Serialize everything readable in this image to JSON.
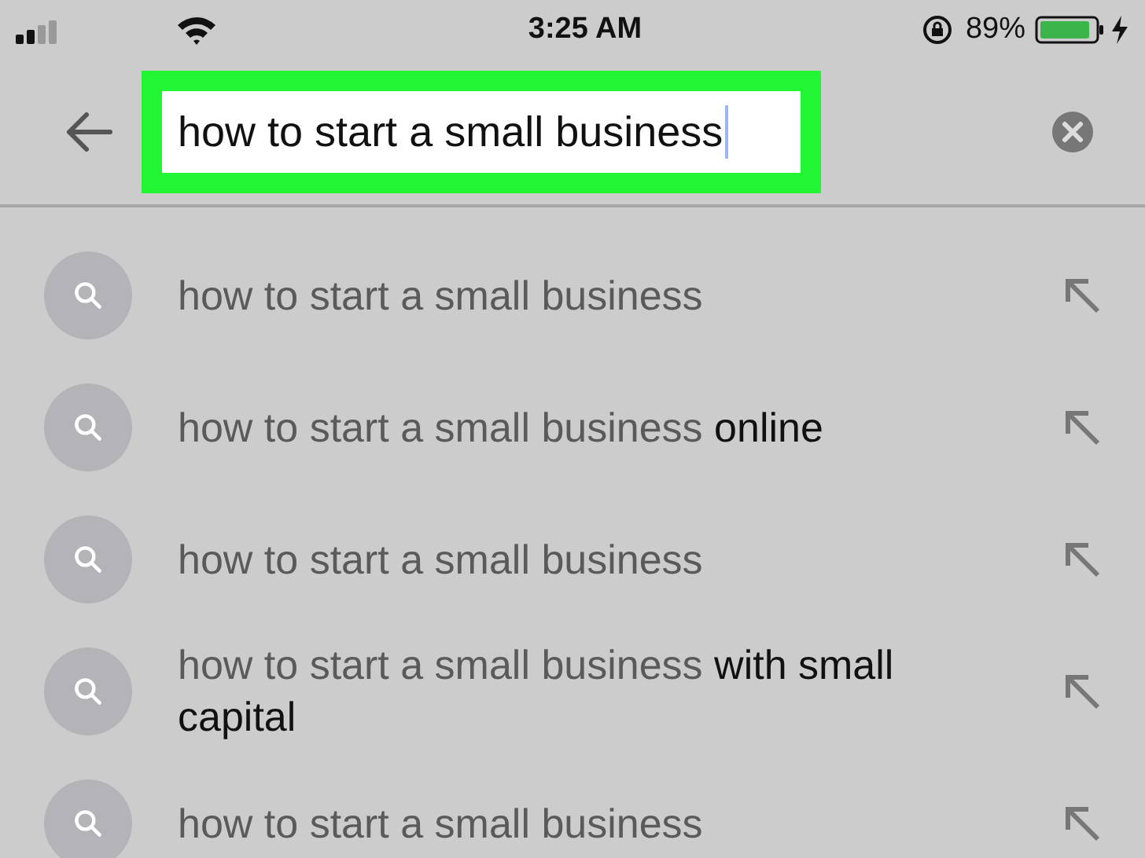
{
  "status_bar": {
    "time": "3:25 AM",
    "battery": "89%"
  },
  "search": {
    "value": "how to start a small business"
  },
  "suggestions": [
    {
      "text": "how to start a small business"
    },
    {
      "text": "how to start a small business **online**"
    },
    {
      "text": "how to start a small business"
    },
    {
      "text": "how to start a small business **with small capital**"
    },
    {
      "text": "how to start a small business"
    }
  ]
}
